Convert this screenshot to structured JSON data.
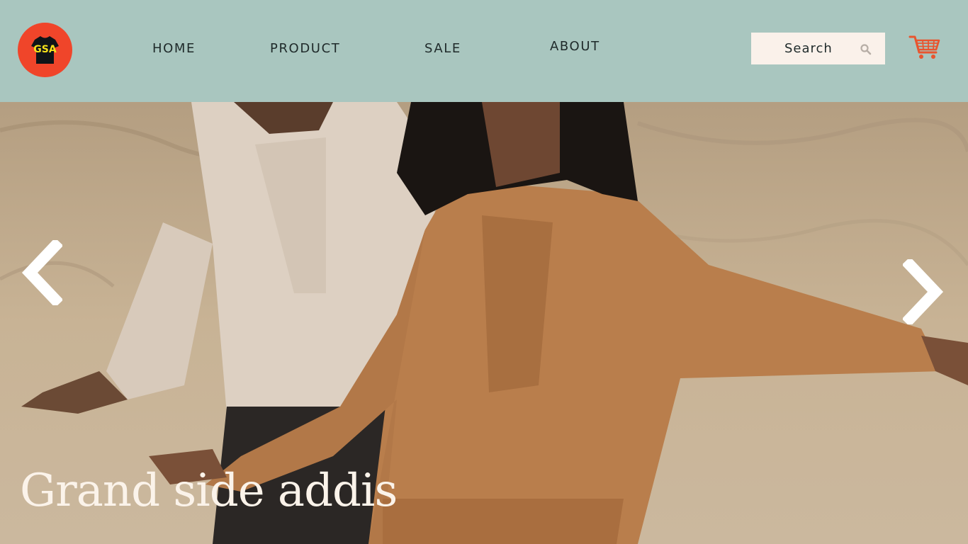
{
  "brand": {
    "logo_text": "GSA",
    "logo_bg": "#f0452a",
    "logo_text_color": "#f7e21a"
  },
  "nav": {
    "items": [
      {
        "label": "HOME"
      },
      {
        "label": "PRODUCT"
      },
      {
        "label": "SALE"
      },
      {
        "label": "ABOUT"
      }
    ]
  },
  "search": {
    "label": "Search",
    "icon": "search-icon"
  },
  "cart": {
    "icon": "cart-icon",
    "color": "#e8552f"
  },
  "hero": {
    "title": "Grand side addis",
    "prev_icon": "chevron-left-icon",
    "next_icon": "chevron-right-icon"
  },
  "colors": {
    "header_bg": "#a9c6bf",
    "search_bg": "#faf1ea",
    "text_dark": "#1f2a2a",
    "hero_text": "#fbf3ea"
  }
}
